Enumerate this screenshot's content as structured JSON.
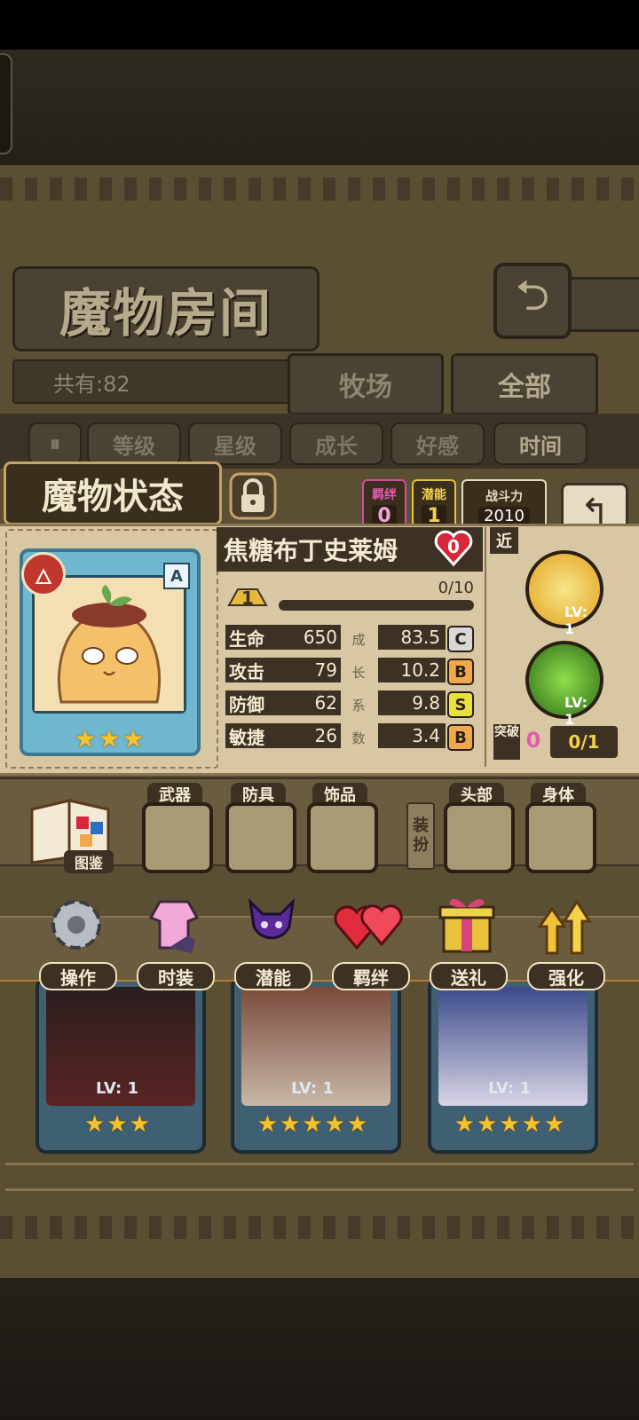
{
  "room": {
    "title": "魔物房间",
    "total": "共有:82",
    "tabs": [
      "牧场",
      "全部"
    ],
    "sort_buttons": [
      "等级",
      "星级",
      "成长",
      "好感",
      "时间"
    ]
  },
  "status": {
    "title": "魔物状态",
    "bond": {
      "label": "羁绊",
      "value": "0"
    },
    "potential": {
      "label": "潜能",
      "value": "1"
    },
    "power": {
      "label": "战斗力",
      "value": "2010"
    }
  },
  "monster": {
    "name": "焦糖布丁史莱姆",
    "affection": "0",
    "rank": "A",
    "stars": 3,
    "level_badge": "1",
    "exp": "0/10",
    "stats": [
      {
        "label": "生命",
        "value": "650",
        "growth": "83.5",
        "grade": "C",
        "grade_color": "#d8d8d8"
      },
      {
        "label": "攻击",
        "value": "79",
        "growth": "10.2",
        "grade": "B",
        "grade_color": "#f0a84a"
      },
      {
        "label": "防御",
        "value": "62",
        "growth": "9.8",
        "grade": "S",
        "grade_color": "#e8e23a"
      },
      {
        "label": "敏捷",
        "value": "26",
        "growth": "3.4",
        "grade": "B",
        "grade_color": "#f0a84a"
      }
    ],
    "growth_chars": [
      "成",
      "长",
      "系",
      "数"
    ],
    "range_tag": "近",
    "skills": [
      {
        "icon": "fist-skill-icon",
        "level": "LV: 1"
      },
      {
        "icon": "poison-skill-icon",
        "level": "LV: 1"
      }
    ],
    "breakthrough": {
      "label": "突破",
      "value": "0",
      "progress": "0/1"
    }
  },
  "equipment": {
    "codex": "图鉴",
    "slots": [
      "武器",
      "防具",
      "饰品",
      "头部",
      "身体"
    ],
    "side_label": [
      "装",
      "扮"
    ]
  },
  "actions": [
    "操作",
    "时装",
    "潜能",
    "羁绊",
    "送礼",
    "强化"
  ],
  "cards": [
    {
      "level": "LV: 1",
      "stars": 3
    },
    {
      "level": "LV: 1",
      "stars": 5
    },
    {
      "level": "LV: 1",
      "stars": 5
    }
  ]
}
